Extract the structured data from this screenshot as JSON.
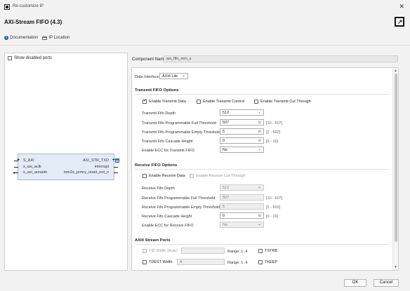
{
  "window": {
    "title": "Re-customize IP"
  },
  "header": {
    "ip_name": "AXI-Stream FIFO (4.3)"
  },
  "links": {
    "documentation": "Documentation",
    "ip_location": "IP Location"
  },
  "left": {
    "show_disabled_ports": "Show disabled ports",
    "block": {
      "inputs": [
        "S_AXI",
        "s_axi_aclk",
        "s_axi_aresetn"
      ],
      "outputs": [
        "AXI_STR_TXD",
        "interrupt",
        "mm2s_prmry_reset_out_n"
      ]
    }
  },
  "component": {
    "label": "Component Name",
    "value": "axi_fifo_mm_s"
  },
  "data_interface": {
    "label": "Data Interface",
    "value": "AXI4 Lite"
  },
  "transmit": {
    "title": "Transmit FIFO Options",
    "enable_data": "Enable Transmit Data",
    "enable_control": "Enable Transmit Control",
    "enable_cut_through": "Enable Transmit Cut Through",
    "rows": [
      {
        "label": "Transmit Fifo Depth",
        "kind": "select",
        "value": "512",
        "range": ""
      },
      {
        "label": "Transmit Fifo Programmable Full Threshold",
        "kind": "num",
        "value": "507",
        "range": "[10 - 507]"
      },
      {
        "label": "Transmit Fifo Programmable Empty Threshold",
        "kind": "num",
        "value": "5",
        "range": "[2 - 502]"
      },
      {
        "label": "Transmit Fifo Cascade Height",
        "kind": "num",
        "value": "0",
        "range": "[0 - 16]"
      },
      {
        "label": "Enable ECC for Transmit FIFO",
        "kind": "select",
        "value": "No",
        "range": ""
      }
    ]
  },
  "receive": {
    "title": "Receive FIFO Options",
    "enable_data": "Enable Receive Data",
    "enable_cut_through": "Enable Receive Cut Through",
    "rows": [
      {
        "label": "Receive Fifo Depth",
        "kind": "select",
        "value": "512",
        "range": ""
      },
      {
        "label": "Receive Fifo Programmable Full Threshold",
        "kind": "num",
        "value": "507",
        "range": "[10 - 507]"
      },
      {
        "label": "Receive Fifo Programmable Empty Threshold",
        "kind": "num",
        "value": "5",
        "range": "[2 - 502]"
      },
      {
        "label": "Receive Fifo Cascade Height",
        "kind": "num",
        "value": "0",
        "range": "[0 - 16]"
      },
      {
        "label": "Enable ECC for Receive FIFO",
        "kind": "select",
        "value": "No",
        "range": ""
      }
    ]
  },
  "axi4_stream": {
    "title": "AXI4 Stream Ports",
    "tid_label": "TID Width (Auto)",
    "tid_value": "",
    "tid_range": "Range: 1..4",
    "tstrb": "TSTRB",
    "tdest_label": "TDEST Width",
    "tdest_value": "4",
    "tdest_range": "Range: 1..4",
    "tkeep": "TKEEP"
  },
  "buttons": {
    "ok": "OK",
    "cancel": "Cancel"
  }
}
